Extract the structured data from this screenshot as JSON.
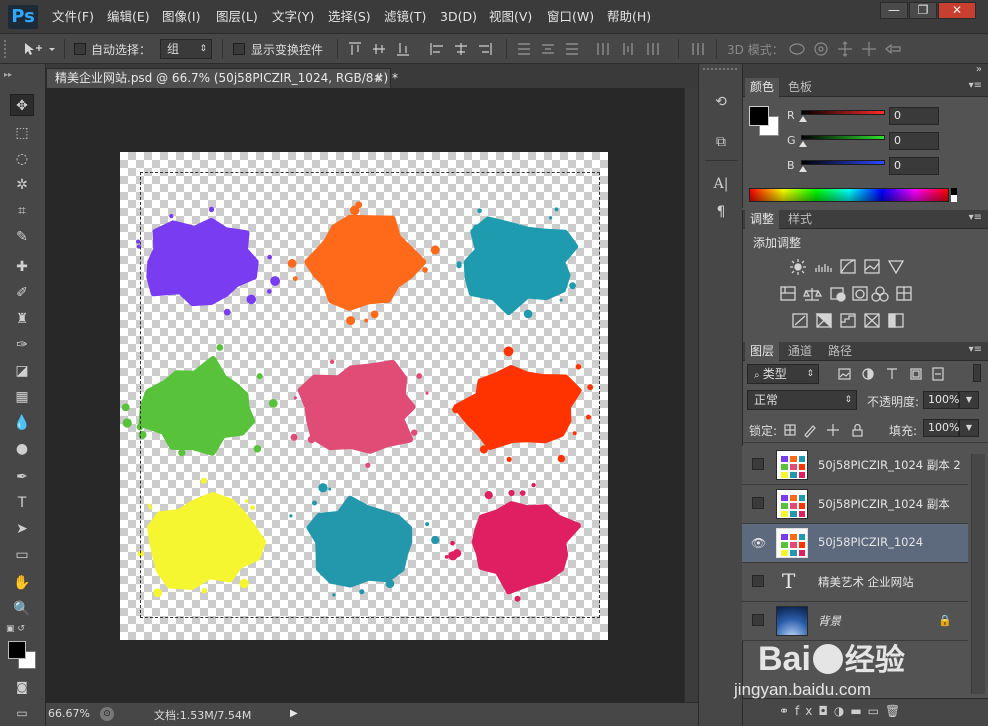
{
  "app": {
    "logo": "Ps",
    "menu": [
      "文件(F)",
      "编辑(E)",
      "图像(I)",
      "图层(L)",
      "文字(Y)",
      "选择(S)",
      "滤镜(T)",
      "3D(D)",
      "视图(V)",
      "窗口(W)",
      "帮助(H)"
    ],
    "window_buttons": [
      "—",
      "❐",
      "✕"
    ]
  },
  "options": {
    "auto_select_label": "自动选择：",
    "auto_select_value": "组",
    "show_transform_label": "显示变换控件",
    "mode_3d_label": "3D 模式："
  },
  "document": {
    "tab_title": "精美企业网站.psd @ 66.7% (50j58PICZIR_1024, RGB/8#) *",
    "tab_close": "×",
    "zoom": "66.67%",
    "doc_info": "文档:1.53M/7.54M",
    "splatter_colors": [
      "#7a3cf0",
      "#ff6a1a",
      "#1f9bb0",
      "#58c23a",
      "#e14c77",
      "#ff3300",
      "#f5f530",
      "#2398ac",
      "#e01f63"
    ]
  },
  "color_panel": {
    "tabs": [
      "颜色",
      "色板"
    ],
    "channels": [
      {
        "label": "R",
        "value": "0",
        "color": "#ff2a2a"
      },
      {
        "label": "G",
        "value": "0",
        "color": "#2ee02e"
      },
      {
        "label": "B",
        "value": "0",
        "color": "#2f48ff"
      }
    ]
  },
  "adjust_panel": {
    "tabs": [
      "调整",
      "样式"
    ],
    "title": "添加调整"
  },
  "layers_panel": {
    "tabs": [
      "图层",
      "通道",
      "路径"
    ],
    "filter_value": "类型",
    "blend_mode": "正常",
    "opacity_label": "不透明度:",
    "opacity_value": "100%",
    "lock_label": "锁定:",
    "fill_label": "填充:",
    "fill_value": "100%",
    "layers": [
      {
        "name": "50j58PICZIR_1024 副本 2",
        "visible": false,
        "selected": false,
        "kind": "image"
      },
      {
        "name": "50j58PICZIR_1024 副本",
        "visible": false,
        "selected": false,
        "kind": "image"
      },
      {
        "name": "50j58PICZIR_1024",
        "visible": true,
        "selected": true,
        "kind": "image"
      },
      {
        "name": "精美艺术 企业网站",
        "visible": false,
        "selected": false,
        "kind": "text"
      },
      {
        "name": "背景",
        "visible": false,
        "selected": false,
        "kind": "background"
      }
    ]
  },
  "watermark": {
    "brand": "Bai",
    "brand2": "经验",
    "url": "jingyan.baidu.com"
  }
}
